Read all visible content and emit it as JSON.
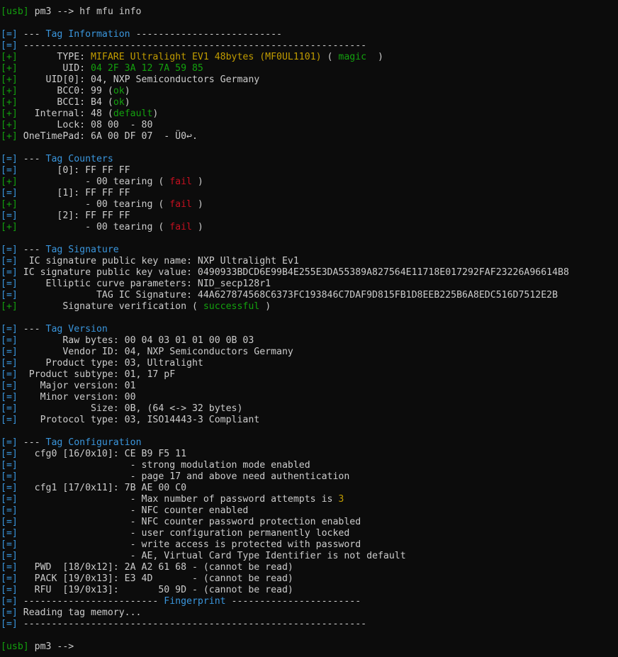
{
  "colors": {
    "default": "#cccccc",
    "green": "#13a10e",
    "blue": "#3a96dd",
    "yellow": "#c19c00",
    "red": "#c50f1f",
    "background": "#0c0c0c"
  },
  "lines": [
    [
      [
        "green",
        "[usb]"
      ],
      [
        "default",
        " pm3 --> hf mfu info"
      ]
    ],
    [],
    [
      [
        "blue",
        "[=]"
      ],
      [
        "default",
        " --- "
      ],
      [
        "blue",
        "Tag Information"
      ],
      [
        "default",
        " --------------------------"
      ]
    ],
    [
      [
        "blue",
        "[=]"
      ],
      [
        "default",
        " -------------------------------------------------------------"
      ]
    ],
    [
      [
        "green",
        "[+]"
      ],
      [
        "default",
        "       TYPE: "
      ],
      [
        "yellow",
        "MIFARE Ultralight EV1 48bytes (MF0UL1101)"
      ],
      [
        "default",
        " ( "
      ],
      [
        "green",
        "magic"
      ],
      [
        "default",
        "  )"
      ]
    ],
    [
      [
        "green",
        "[+]"
      ],
      [
        "default",
        "        UID: "
      ],
      [
        "green",
        "04 2F 3A 12 7A 59 85"
      ]
    ],
    [
      [
        "green",
        "[+]"
      ],
      [
        "default",
        "     UID[0]: 04, NXP Semiconductors Germany"
      ]
    ],
    [
      [
        "green",
        "[+]"
      ],
      [
        "default",
        "       BCC0: 99 ("
      ],
      [
        "green",
        "ok"
      ],
      [
        "default",
        ")"
      ]
    ],
    [
      [
        "green",
        "[+]"
      ],
      [
        "default",
        "       BCC1: B4 ("
      ],
      [
        "green",
        "ok"
      ],
      [
        "default",
        ")"
      ]
    ],
    [
      [
        "green",
        "[+]"
      ],
      [
        "default",
        "   Internal: 48 ("
      ],
      [
        "green",
        "default"
      ],
      [
        "default",
        ")"
      ]
    ],
    [
      [
        "green",
        "[+]"
      ],
      [
        "default",
        "       Lock: 08 00  - 80"
      ]
    ],
    [
      [
        "green",
        "[+]"
      ],
      [
        "default",
        " OneTimePad: 6A 00 DF 07  - Ü0↩."
      ]
    ],
    [],
    [
      [
        "blue",
        "[=]"
      ],
      [
        "default",
        " --- "
      ],
      [
        "blue",
        "Tag Counters"
      ]
    ],
    [
      [
        "blue",
        "[=]"
      ],
      [
        "default",
        "       [0]: FF FF FF"
      ]
    ],
    [
      [
        "green",
        "[+]"
      ],
      [
        "default",
        "            - 00 tearing ( "
      ],
      [
        "red",
        "fail"
      ],
      [
        "default",
        " )"
      ]
    ],
    [
      [
        "blue",
        "[=]"
      ],
      [
        "default",
        "       [1]: FF FF FF"
      ]
    ],
    [
      [
        "green",
        "[+]"
      ],
      [
        "default",
        "            - 00 tearing ( "
      ],
      [
        "red",
        "fail"
      ],
      [
        "default",
        " )"
      ]
    ],
    [
      [
        "blue",
        "[=]"
      ],
      [
        "default",
        "       [2]: FF FF FF"
      ]
    ],
    [
      [
        "green",
        "[+]"
      ],
      [
        "default",
        "            - 00 tearing ( "
      ],
      [
        "red",
        "fail"
      ],
      [
        "default",
        " )"
      ]
    ],
    [],
    [
      [
        "blue",
        "[=]"
      ],
      [
        "default",
        " --- "
      ],
      [
        "blue",
        "Tag Signature"
      ]
    ],
    [
      [
        "blue",
        "[=]"
      ],
      [
        "default",
        "  IC signature public key name: NXP Ultralight Ev1"
      ]
    ],
    [
      [
        "blue",
        "[=]"
      ],
      [
        "default",
        " IC signature public key value: 0490933BDCD6E99B4E255E3DA55389A827564E11718E017292FAF23226A96614B8"
      ]
    ],
    [
      [
        "blue",
        "[=]"
      ],
      [
        "default",
        "     Elliptic curve parameters: NID_secp128r1"
      ]
    ],
    [
      [
        "blue",
        "[=]"
      ],
      [
        "default",
        "              TAG IC Signature: 44A627874568C6373FC193846C7DAF9D815FB1D8EEB225B6A8EDC516D7512E2B"
      ]
    ],
    [
      [
        "green",
        "[+]"
      ],
      [
        "default",
        "        Signature verification ( "
      ],
      [
        "green",
        "successful"
      ],
      [
        "default",
        " )"
      ]
    ],
    [],
    [
      [
        "blue",
        "[=]"
      ],
      [
        "default",
        " --- "
      ],
      [
        "blue",
        "Tag Version"
      ]
    ],
    [
      [
        "blue",
        "[=]"
      ],
      [
        "default",
        "        Raw bytes: 00 04 03 01 01 00 0B 03"
      ]
    ],
    [
      [
        "blue",
        "[=]"
      ],
      [
        "default",
        "        Vendor ID: 04, NXP Semiconductors Germany"
      ]
    ],
    [
      [
        "blue",
        "[=]"
      ],
      [
        "default",
        "     Product type: 03, Ultralight"
      ]
    ],
    [
      [
        "blue",
        "[=]"
      ],
      [
        "default",
        "  Product subtype: 01, 17 pF"
      ]
    ],
    [
      [
        "blue",
        "[=]"
      ],
      [
        "default",
        "    Major version: 01"
      ]
    ],
    [
      [
        "blue",
        "[=]"
      ],
      [
        "default",
        "    Minor version: 00"
      ]
    ],
    [
      [
        "blue",
        "[=]"
      ],
      [
        "default",
        "             Size: 0B, (64 <-> 32 bytes)"
      ]
    ],
    [
      [
        "blue",
        "[=]"
      ],
      [
        "default",
        "    Protocol type: 03, ISO14443-3 Compliant"
      ]
    ],
    [],
    [
      [
        "blue",
        "[=]"
      ],
      [
        "default",
        " --- "
      ],
      [
        "blue",
        "Tag Configuration"
      ]
    ],
    [
      [
        "blue",
        "[=]"
      ],
      [
        "default",
        "   cfg0 [16/0x10]: CE B9 F5 11"
      ]
    ],
    [
      [
        "blue",
        "[=]"
      ],
      [
        "default",
        "                    - strong modulation mode enabled"
      ]
    ],
    [
      [
        "blue",
        "[=]"
      ],
      [
        "default",
        "                    - page 17 and above need authentication"
      ]
    ],
    [
      [
        "blue",
        "[=]"
      ],
      [
        "default",
        "   cfg1 [17/0x11]: 7B AE 00 C0"
      ]
    ],
    [
      [
        "blue",
        "[=]"
      ],
      [
        "default",
        "                    - Max number of password attempts is "
      ],
      [
        "yellow",
        "3"
      ]
    ],
    [
      [
        "blue",
        "[=]"
      ],
      [
        "default",
        "                    - NFC counter enabled"
      ]
    ],
    [
      [
        "blue",
        "[=]"
      ],
      [
        "default",
        "                    - NFC counter password protection enabled"
      ]
    ],
    [
      [
        "blue",
        "[=]"
      ],
      [
        "default",
        "                    - user configuration permanently locked"
      ]
    ],
    [
      [
        "blue",
        "[=]"
      ],
      [
        "default",
        "                    - write access is protected with password"
      ]
    ],
    [
      [
        "blue",
        "[=]"
      ],
      [
        "default",
        "                    - AE, Virtual Card Type Identifier is not default"
      ]
    ],
    [
      [
        "blue",
        "[=]"
      ],
      [
        "default",
        "   PWD  [18/0x12]: 2A A2 61 68 - (cannot be read)"
      ]
    ],
    [
      [
        "blue",
        "[=]"
      ],
      [
        "default",
        "   PACK [19/0x13]: E3 4D       - (cannot be read)"
      ]
    ],
    [
      [
        "blue",
        "[=]"
      ],
      [
        "default",
        "   RFU  [19/0x13]:       50 9D - (cannot be read)"
      ]
    ],
    [
      [
        "blue",
        "[=]"
      ],
      [
        "default",
        " ------------------------ "
      ],
      [
        "blue",
        "Fingerprint"
      ],
      [
        "default",
        " -----------------------"
      ]
    ],
    [
      [
        "blue",
        "[=]"
      ],
      [
        "default",
        " Reading tag memory..."
      ]
    ],
    [
      [
        "blue",
        "[=]"
      ],
      [
        "default",
        " -------------------------------------------------------------"
      ]
    ],
    [],
    [
      [
        "green",
        "[usb]"
      ],
      [
        "default",
        " pm3 -->"
      ]
    ]
  ]
}
